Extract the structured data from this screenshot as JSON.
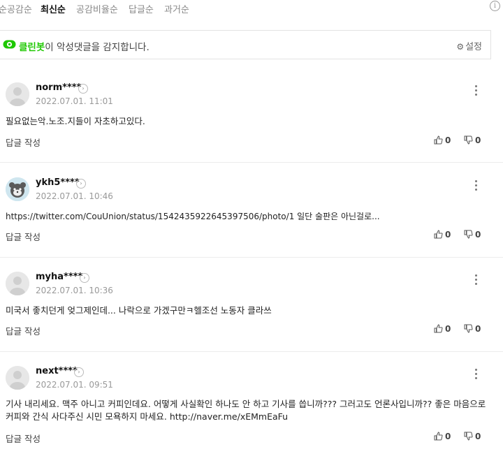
{
  "sort_tabs": [
    {
      "label": "순공감순"
    },
    {
      "label": "최신순"
    },
    {
      "label": "공감비율순"
    },
    {
      "label": "답글순"
    },
    {
      "label": "과거순"
    }
  ],
  "info_label": "i",
  "cleanbot": {
    "name": "클린봇",
    "message": "이 악성댓글을 감지합니다.",
    "settings_label": "설정"
  },
  "comments": [
    {
      "nickname": "norm****",
      "date": "2022.07.01. 11:01",
      "text": "필요없는악.노조.지들이 자초하고있다.",
      "reply_label": "답글 작성",
      "likes": "0",
      "dislikes": "0"
    },
    {
      "nickname": "ykh5****",
      "date": "2022.07.01. 10:46",
      "text": "https://twitter.com/CouUnion/status/1542435922645397506/photo/1 일단 술판은 아닌걸로...",
      "reply_label": "답글 작성",
      "likes": "0",
      "dislikes": "0"
    },
    {
      "nickname": "myha****",
      "date": "2022.07.01. 10:36",
      "text": "미국서 좋치던게 엊그제인데... 나락으로 가겠구만ㅋ헬조선 노동자 클라쓰",
      "reply_label": "답글 작성",
      "likes": "0",
      "dislikes": "0"
    },
    {
      "nickname": "next****",
      "date": "2022.07.01. 09:51",
      "text": "기사 내리세요. 맥주 아니고 커피인데요. 어떻게 사실확인 하나도 안 하고 기사를 씁니까??? 그러고도 언론사입니까?? 좋은 마음으로 커피와 간식 사다주신 시민 모욕하지 마세요. http://naver.me/xEMmEaFu",
      "reply_label": "답글 작성",
      "likes": "0",
      "dislikes": "0"
    }
  ]
}
